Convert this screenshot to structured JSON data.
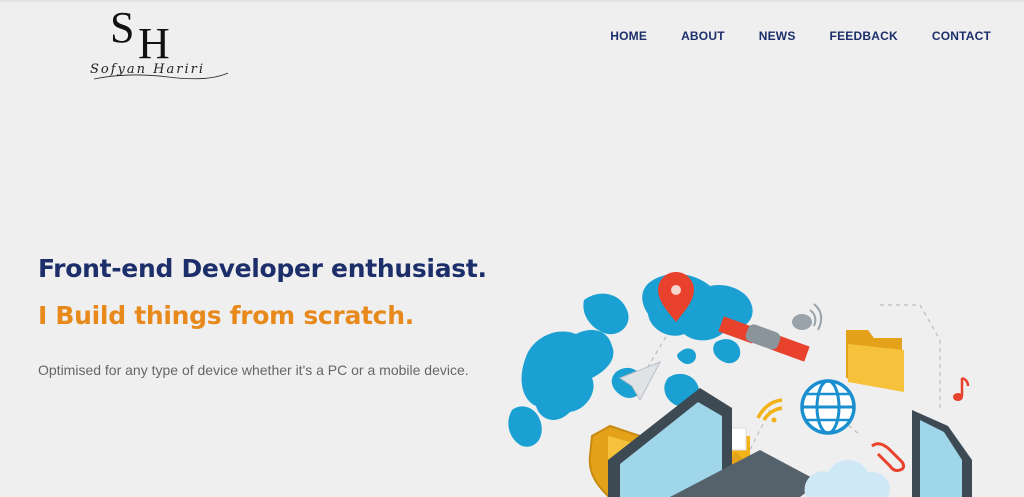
{
  "brand": {
    "monogram_s": "S",
    "monogram_h": "H",
    "signature": "Sofyan Hariri"
  },
  "nav": {
    "items": [
      {
        "label": "HOME"
      },
      {
        "label": "ABOUT"
      },
      {
        "label": "NEWS"
      },
      {
        "label": "FEEDBACK"
      },
      {
        "label": "CONTACT"
      }
    ]
  },
  "hero": {
    "title": "Front-end Developer enthusiast.",
    "subtitle": "I Build things from scratch.",
    "description": "Optimised for any type of device whether it's a PC or a mobile device."
  },
  "colors": {
    "background": "#efefef",
    "nav_text": "#1c2f6b",
    "title": "#1c2f6b",
    "subtitle": "#e8891c",
    "description": "#666666",
    "map_blue": "#1aa0d2"
  },
  "illustration": {
    "icons": [
      "map-pin-icon",
      "satellite-icon",
      "folder-icon",
      "music-note-icon",
      "wifi-icon",
      "globe-icon",
      "mail-icon",
      "shield-icon",
      "paperclip-icon",
      "cloud-icon",
      "laptop-icon",
      "tablet-icon",
      "paper-plane-icon",
      "world-map-icon"
    ]
  }
}
